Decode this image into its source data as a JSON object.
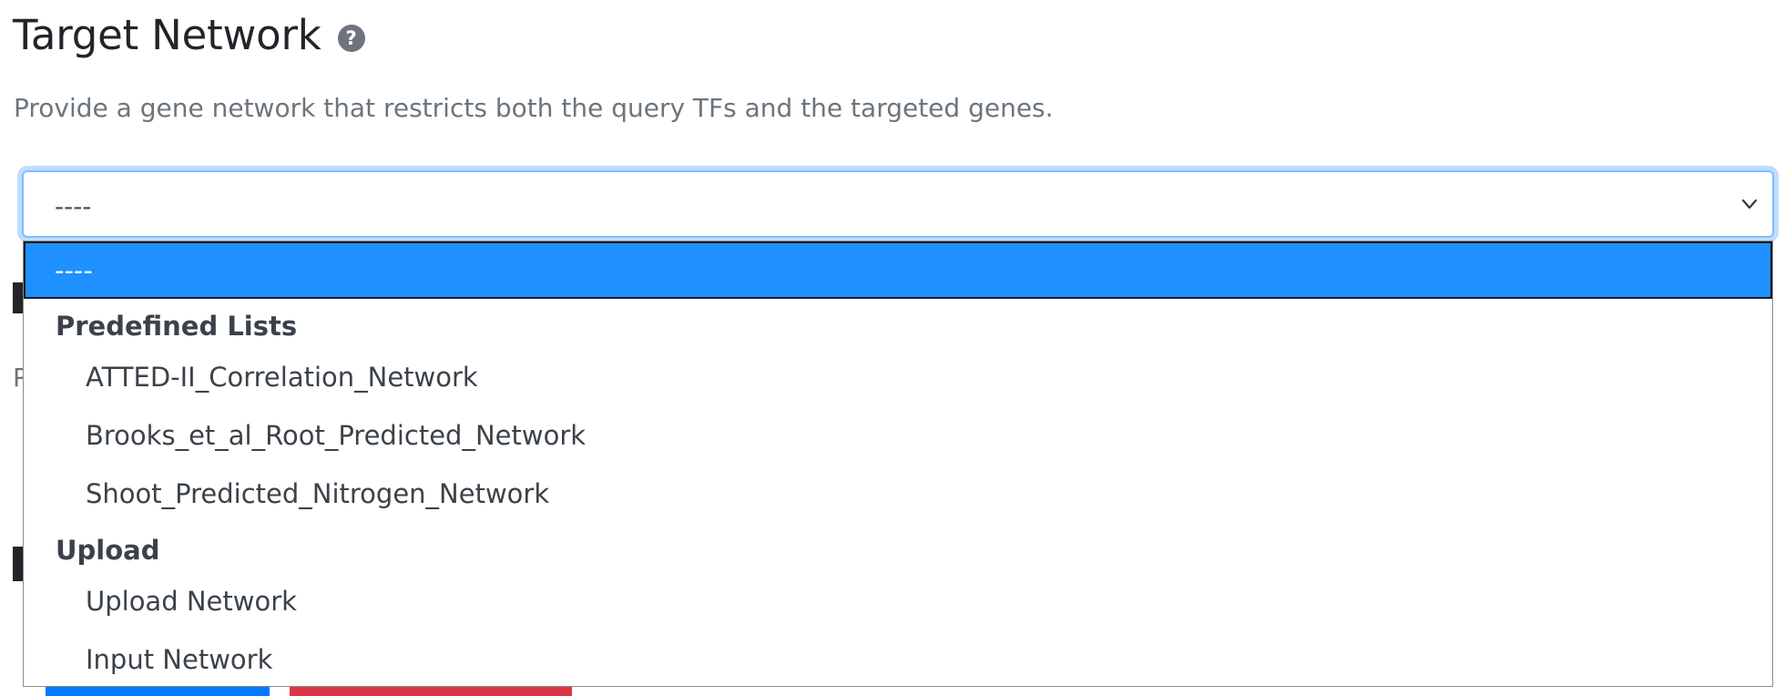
{
  "header": {
    "title": "Target Network",
    "help_icon": "question-circle-icon"
  },
  "description": "Provide a gene network that restricts both the query TFs and the targeted genes.",
  "select": {
    "current_value": "----",
    "chevron_icon": "chevron-down-icon"
  },
  "background_fragments": {
    "paragraph_initial": "P"
  },
  "dropdown": {
    "selected_option": "----",
    "groups": [
      {
        "label": "Predefined Lists",
        "options": [
          "ATTED-II_Correlation_Network",
          "Brooks_et_al_Root_Predicted_Network",
          "Shoot_Predicted_Nitrogen_Network"
        ]
      },
      {
        "label": "Upload",
        "options": [
          "Upload Network",
          "Input Network"
        ]
      }
    ]
  },
  "colors": {
    "highlight": "#1e90ff",
    "focus_border": "#80bdff",
    "muted_text": "#6c757d"
  }
}
